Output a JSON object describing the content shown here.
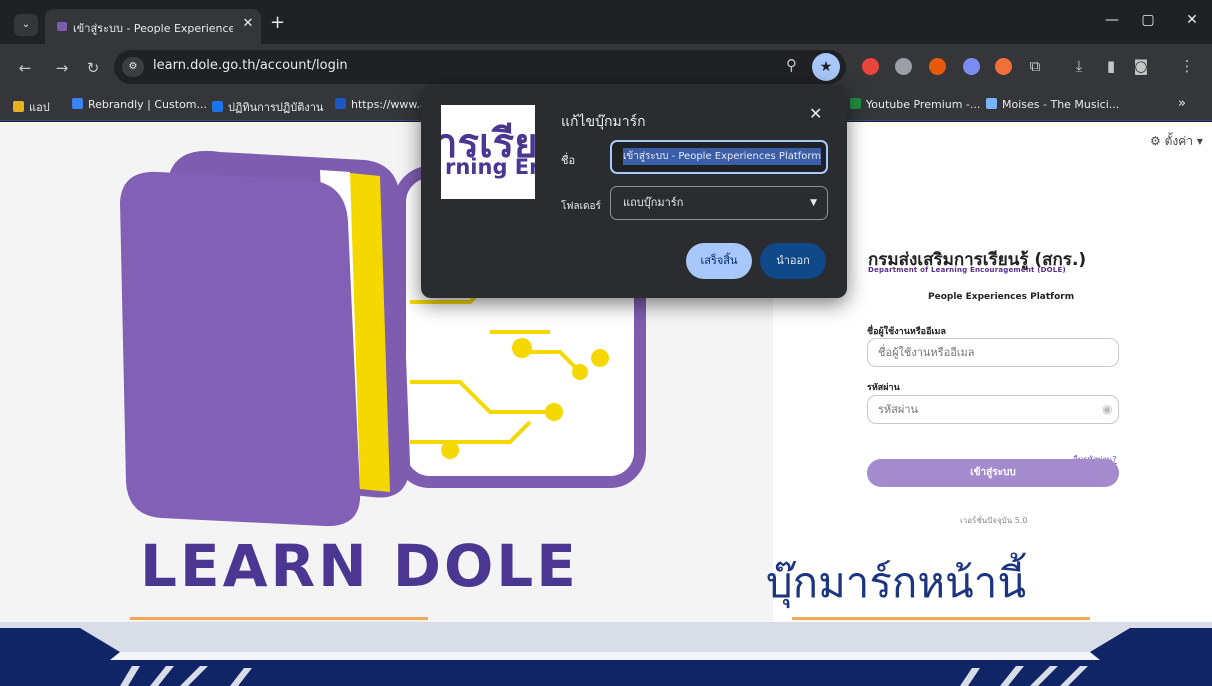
{
  "browser": {
    "tab_title": "เข้าสู่ระบบ - People Experiences Platform",
    "url": "learn.dole.go.th/account/login",
    "bookmarks": [
      {
        "label": "แอป",
        "color": "#e7b124"
      },
      {
        "label": "Rebrandly | Custom...",
        "color": "#3b82f6"
      },
      {
        "label": "ปฏิทินการปฏิบัติงาน",
        "color": "#1a73e8"
      },
      {
        "label": "https://www.a...",
        "color": "#1a56c4"
      },
      {
        "label": "Youtube Premium -...",
        "color": "#1e8e3e"
      },
      {
        "label": "Moises - The Musici...",
        "color": "#7ab3ff"
      }
    ],
    "overflow_label": "»"
  },
  "dialog": {
    "title": "แก้ไขบุ๊กมาร์ก",
    "name_label": "ชื่อ",
    "name_value": "เข้าสู่ระบบ - People Experiences Platform",
    "folder_label": "โฟลเดอร์",
    "folder_value": "แถบบุ๊กมาร์ก",
    "done_label": "เสร็จสิ้น",
    "remove_label": "นำออก",
    "thumbnail_thai": "ารเรีย",
    "thumbnail_en": "rning Enc"
  },
  "page": {
    "settings_label": "ตั้งค่า ▾",
    "brand_title": "LEARN DOLE",
    "caption": "บุ๊กมาร์กหน้านี้",
    "org_name": "กรมส่งเสริมการเรียนรู้ (สกร.)",
    "org_name_en": "Department of Learning Encouragement (DOLE)",
    "platform_name": "People Experiences Platform",
    "username_label": "ชื่อผู้ใช้งานหรืออีเมล",
    "username_placeholder": "ชื่อผู้ใช้งานหรืออีเมล",
    "password_label": "รหัสผ่าน",
    "password_placeholder": "รหัสผ่าน",
    "forgot_label": "ลืมรหัสผ่าน?",
    "login_label": "เข้าสู่ระบบ",
    "version_text": "เวอร์ชั่นปัจจุบัน 5.0"
  },
  "colors": {
    "brand_purple": "#4b3792",
    "book_purple": "#7e5cb0",
    "book_yellow": "#f5d800",
    "accent_blue": "#a8c7fa"
  }
}
